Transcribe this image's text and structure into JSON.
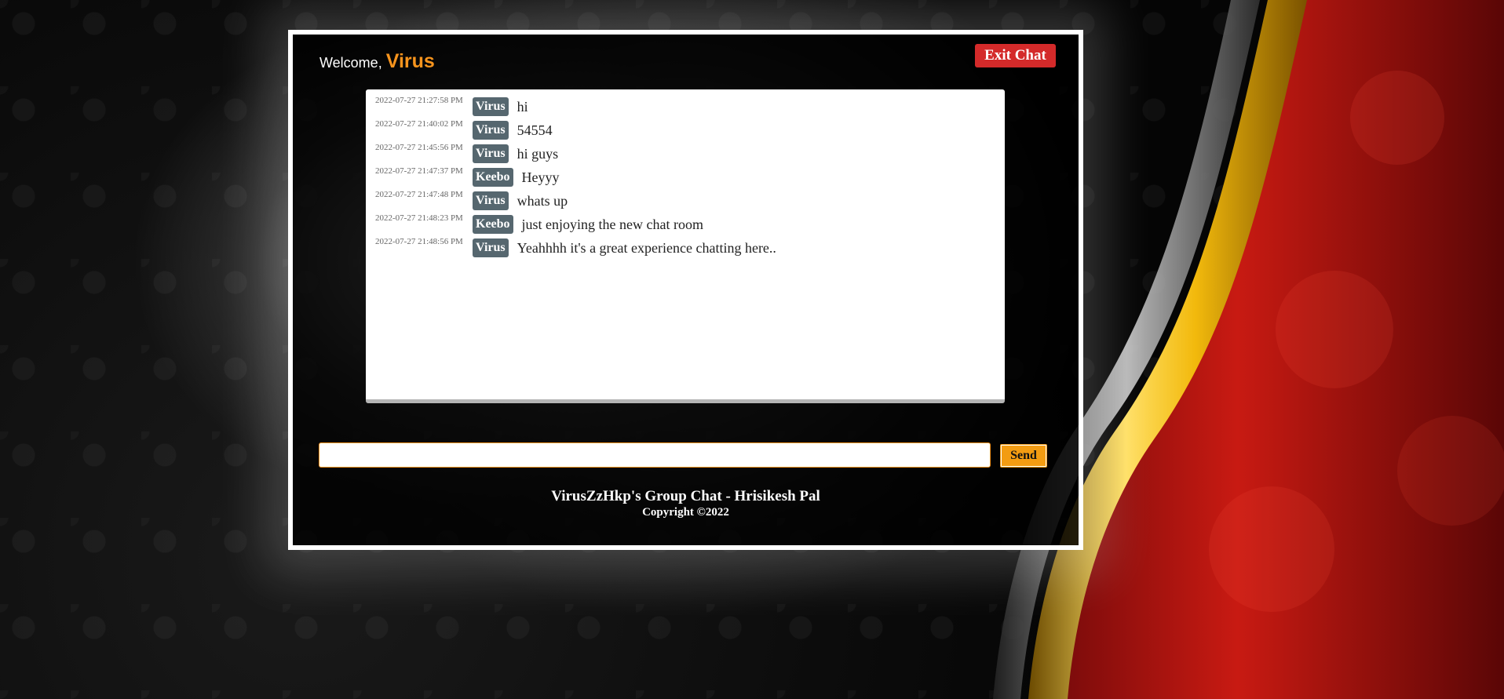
{
  "header": {
    "welcome_text": "Welcome,",
    "username": "Virus",
    "exit_label": "Exit Chat"
  },
  "messages": [
    {
      "time": "2022-07-27 21:27:58 PM",
      "user": "Virus",
      "text": "hi"
    },
    {
      "time": "2022-07-27 21:40:02 PM",
      "user": "Virus",
      "text": "54554"
    },
    {
      "time": "2022-07-27 21:45:56 PM",
      "user": "Virus",
      "text": "hi guys"
    },
    {
      "time": "2022-07-27 21:47:37 PM",
      "user": "Keebo",
      "text": "Heyyy"
    },
    {
      "time": "2022-07-27 21:47:48 PM",
      "user": "Virus",
      "text": "whats up"
    },
    {
      "time": "2022-07-27 21:48:23 PM",
      "user": "Keebo",
      "text": "just enjoying the new chat room"
    },
    {
      "time": "2022-07-27 21:48:56 PM",
      "user": "Virus",
      "text": "Yeahhhh it's a great experience chatting here.."
    }
  ],
  "composer": {
    "value": "",
    "send_label": "Send"
  },
  "footer": {
    "title": "VirusZzHkp's Group Chat - Hrisikesh Pal",
    "copyright": "Copyright ©2022"
  },
  "colors": {
    "accent": "#f7941d",
    "exit_button": "#d42a2a",
    "user_badge": "#56676f",
    "send_button": "#f39c12"
  }
}
